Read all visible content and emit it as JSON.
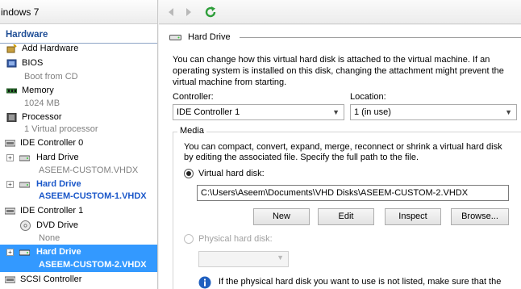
{
  "vm_title": "indows 7",
  "tree": {
    "section": "Hardware",
    "items": [
      {
        "label": "Add Hardware"
      },
      {
        "label": "BIOS",
        "sub": "Boot from CD"
      },
      {
        "label": "Memory",
        "sub": "1024 MB"
      },
      {
        "label": "Processor",
        "sub": "1 Virtual processor"
      },
      {
        "label": "IDE Controller 0"
      },
      {
        "label": "Hard Drive",
        "sub": "ASEEM-CUSTOM.VHDX"
      },
      {
        "label": "Hard Drive",
        "sub": "ASEEM-CUSTOM-1.VHDX"
      },
      {
        "label": "IDE Controller 1"
      },
      {
        "label": "DVD Drive",
        "sub": "None"
      },
      {
        "label": "Hard Drive",
        "sub": "ASEEM-CUSTOM-2.VHDX"
      },
      {
        "label": "SCSI Controller"
      }
    ],
    "expander_plus": "+"
  },
  "panel": {
    "title": "Hard Drive",
    "intro": [
      "You can change how this virtual hard disk is attached to the virtual machine. If an",
      "operating system is installed on this disk, changing the attachment might prevent the",
      "virtual machine from starting."
    ],
    "controller_label": "Controller:",
    "controller_value": "IDE Controller 1",
    "location_label": "Location:",
    "location_value": "1 (in use)",
    "media_label": "Media",
    "media_desc": [
      "You can compact, convert, expand, merge, reconnect or shrink a virtual hard disk",
      "by editing the associated file. Specify the full path to the file."
    ],
    "vhd_radio_label": "Virtual hard disk:",
    "vhd_path": "C:\\Users\\Aseem\\Documents\\VHD Disks\\ASEEM-CUSTOM-2.VHDX",
    "buttons": {
      "new": "New",
      "edit": "Edit",
      "inspect": "Inspect",
      "browse": "Browse..."
    },
    "phys_radio_label": "Physical hard disk:",
    "info_text": "If the physical hard disk you want to use is not listed, make sure that the"
  },
  "colors": {
    "accent": "#3399ff",
    "section_blue": "#1f4e96",
    "link_blue": "#1a57c9"
  },
  "icons": [
    "back-arrow-icon",
    "forward-arrow-icon",
    "refresh-icon",
    "hard-drive-icon",
    "info-icon"
  ]
}
